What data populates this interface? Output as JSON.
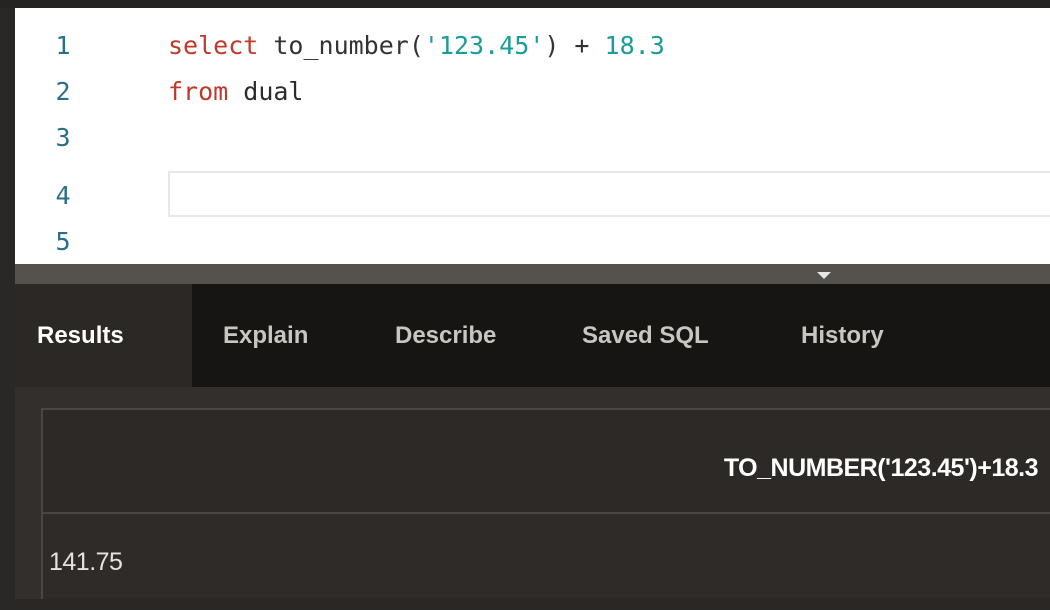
{
  "editor": {
    "lines": [
      {
        "number": "1",
        "tokens": [
          {
            "type": "kw",
            "text": "select"
          },
          {
            "type": "op",
            "text": " "
          },
          {
            "type": "fn",
            "text": "to_number"
          },
          {
            "type": "op",
            "text": "("
          },
          {
            "type": "str",
            "text": "'123.45'"
          },
          {
            "type": "op",
            "text": ") + "
          },
          {
            "type": "num",
            "text": "18.3"
          }
        ]
      },
      {
        "number": "2",
        "tokens": [
          {
            "type": "kw",
            "text": "from"
          },
          {
            "type": "op",
            "text": " "
          },
          {
            "type": "ident",
            "text": "dual"
          }
        ]
      },
      {
        "number": "3",
        "tokens": []
      },
      {
        "number": "4",
        "tokens": []
      },
      {
        "number": "5",
        "tokens": []
      }
    ]
  },
  "tabs": [
    {
      "label": "Results",
      "active": true
    },
    {
      "label": "Explain",
      "active": false
    },
    {
      "label": "Describe",
      "active": false
    },
    {
      "label": "Saved SQL",
      "active": false
    },
    {
      "label": "History",
      "active": false
    }
  ],
  "results": {
    "column_header": "TO_NUMBER('123.45')+18.3",
    "rows": [
      {
        "value": "141.75"
      }
    ]
  },
  "icons": {
    "splitter": "collapse-arrow-down-icon"
  }
}
